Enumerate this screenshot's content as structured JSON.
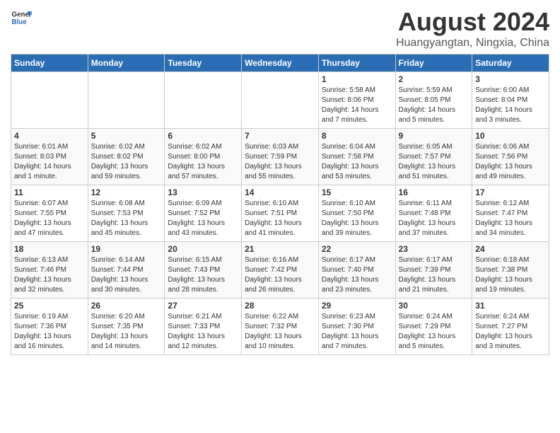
{
  "header": {
    "logo_general": "General",
    "logo_blue": "Blue",
    "title": "August 2024",
    "subtitle": "Huangyangtan, Ningxia, China"
  },
  "days_of_week": [
    "Sunday",
    "Monday",
    "Tuesday",
    "Wednesday",
    "Thursday",
    "Friday",
    "Saturday"
  ],
  "weeks": [
    [
      {
        "day": "",
        "info": ""
      },
      {
        "day": "",
        "info": ""
      },
      {
        "day": "",
        "info": ""
      },
      {
        "day": "",
        "info": ""
      },
      {
        "day": "1",
        "info": "Sunrise: 5:58 AM\nSunset: 8:06 PM\nDaylight: 14 hours\nand 7 minutes."
      },
      {
        "day": "2",
        "info": "Sunrise: 5:59 AM\nSunset: 8:05 PM\nDaylight: 14 hours\nand 5 minutes."
      },
      {
        "day": "3",
        "info": "Sunrise: 6:00 AM\nSunset: 8:04 PM\nDaylight: 14 hours\nand 3 minutes."
      }
    ],
    [
      {
        "day": "4",
        "info": "Sunrise: 6:01 AM\nSunset: 8:03 PM\nDaylight: 14 hours\nand 1 minute."
      },
      {
        "day": "5",
        "info": "Sunrise: 6:02 AM\nSunset: 8:02 PM\nDaylight: 13 hours\nand 59 minutes."
      },
      {
        "day": "6",
        "info": "Sunrise: 6:02 AM\nSunset: 8:00 PM\nDaylight: 13 hours\nand 57 minutes."
      },
      {
        "day": "7",
        "info": "Sunrise: 6:03 AM\nSunset: 7:59 PM\nDaylight: 13 hours\nand 55 minutes."
      },
      {
        "day": "8",
        "info": "Sunrise: 6:04 AM\nSunset: 7:58 PM\nDaylight: 13 hours\nand 53 minutes."
      },
      {
        "day": "9",
        "info": "Sunrise: 6:05 AM\nSunset: 7:57 PM\nDaylight: 13 hours\nand 51 minutes."
      },
      {
        "day": "10",
        "info": "Sunrise: 6:06 AM\nSunset: 7:56 PM\nDaylight: 13 hours\nand 49 minutes."
      }
    ],
    [
      {
        "day": "11",
        "info": "Sunrise: 6:07 AM\nSunset: 7:55 PM\nDaylight: 13 hours\nand 47 minutes."
      },
      {
        "day": "12",
        "info": "Sunrise: 6:08 AM\nSunset: 7:53 PM\nDaylight: 13 hours\nand 45 minutes."
      },
      {
        "day": "13",
        "info": "Sunrise: 6:09 AM\nSunset: 7:52 PM\nDaylight: 13 hours\nand 43 minutes."
      },
      {
        "day": "14",
        "info": "Sunrise: 6:10 AM\nSunset: 7:51 PM\nDaylight: 13 hours\nand 41 minutes."
      },
      {
        "day": "15",
        "info": "Sunrise: 6:10 AM\nSunset: 7:50 PM\nDaylight: 13 hours\nand 39 minutes."
      },
      {
        "day": "16",
        "info": "Sunrise: 6:11 AM\nSunset: 7:48 PM\nDaylight: 13 hours\nand 37 minutes."
      },
      {
        "day": "17",
        "info": "Sunrise: 6:12 AM\nSunset: 7:47 PM\nDaylight: 13 hours\nand 34 minutes."
      }
    ],
    [
      {
        "day": "18",
        "info": "Sunrise: 6:13 AM\nSunset: 7:46 PM\nDaylight: 13 hours\nand 32 minutes."
      },
      {
        "day": "19",
        "info": "Sunrise: 6:14 AM\nSunset: 7:44 PM\nDaylight: 13 hours\nand 30 minutes."
      },
      {
        "day": "20",
        "info": "Sunrise: 6:15 AM\nSunset: 7:43 PM\nDaylight: 13 hours\nand 28 minutes."
      },
      {
        "day": "21",
        "info": "Sunrise: 6:16 AM\nSunset: 7:42 PM\nDaylight: 13 hours\nand 26 minutes."
      },
      {
        "day": "22",
        "info": "Sunrise: 6:17 AM\nSunset: 7:40 PM\nDaylight: 13 hours\nand 23 minutes."
      },
      {
        "day": "23",
        "info": "Sunrise: 6:17 AM\nSunset: 7:39 PM\nDaylight: 13 hours\nand 21 minutes."
      },
      {
        "day": "24",
        "info": "Sunrise: 6:18 AM\nSunset: 7:38 PM\nDaylight: 13 hours\nand 19 minutes."
      }
    ],
    [
      {
        "day": "25",
        "info": "Sunrise: 6:19 AM\nSunset: 7:36 PM\nDaylight: 13 hours\nand 16 minutes."
      },
      {
        "day": "26",
        "info": "Sunrise: 6:20 AM\nSunset: 7:35 PM\nDaylight: 13 hours\nand 14 minutes."
      },
      {
        "day": "27",
        "info": "Sunrise: 6:21 AM\nSunset: 7:33 PM\nDaylight: 13 hours\nand 12 minutes."
      },
      {
        "day": "28",
        "info": "Sunrise: 6:22 AM\nSunset: 7:32 PM\nDaylight: 13 hours\nand 10 minutes."
      },
      {
        "day": "29",
        "info": "Sunrise: 6:23 AM\nSunset: 7:30 PM\nDaylight: 13 hours\nand 7 minutes."
      },
      {
        "day": "30",
        "info": "Sunrise: 6:24 AM\nSunset: 7:29 PM\nDaylight: 13 hours\nand 5 minutes."
      },
      {
        "day": "31",
        "info": "Sunrise: 6:24 AM\nSunset: 7:27 PM\nDaylight: 13 hours\nand 3 minutes."
      }
    ]
  ]
}
